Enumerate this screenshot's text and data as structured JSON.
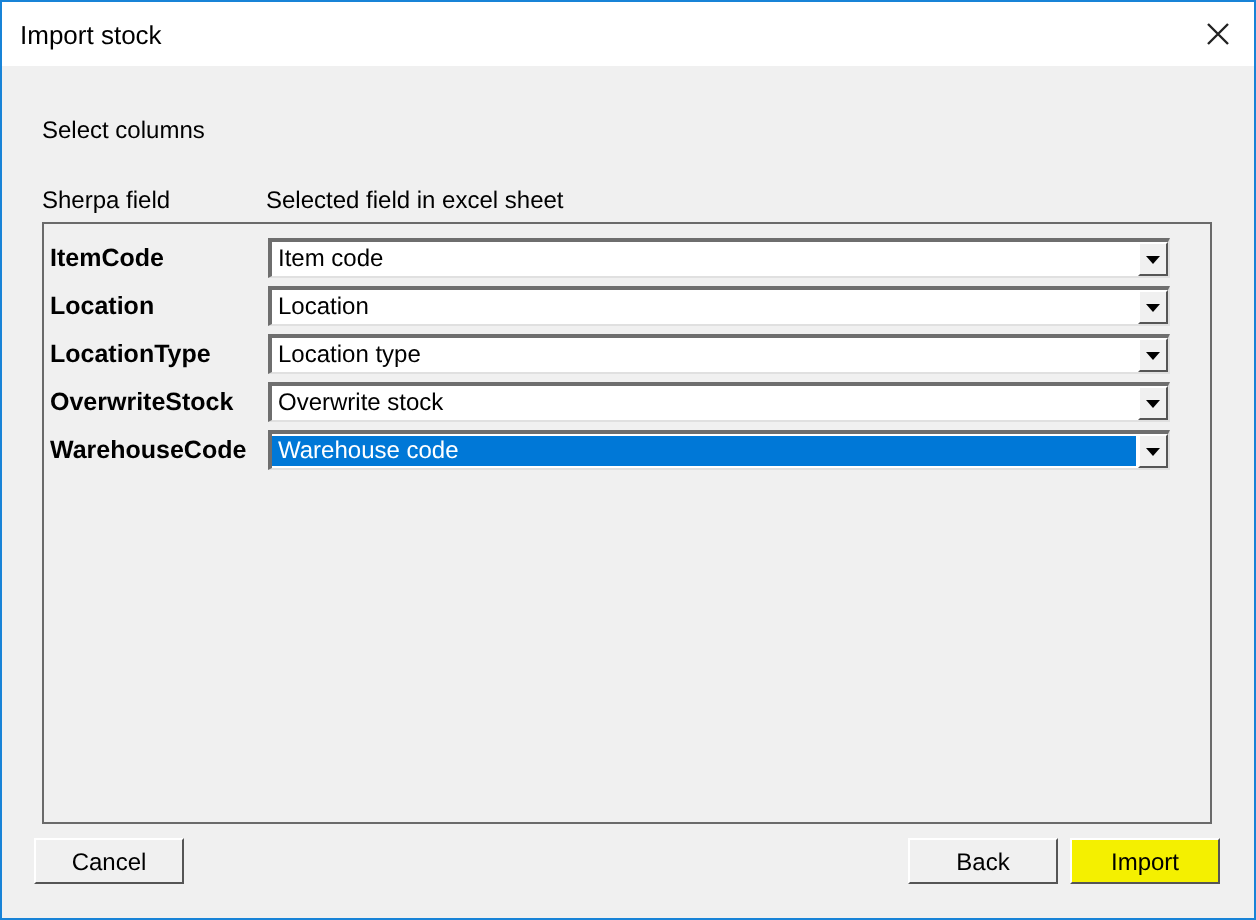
{
  "window": {
    "title": "Import stock"
  },
  "instruction": "Select columns",
  "columns": [
    "Sherpa field",
    "Selected field in excel sheet"
  ],
  "mappings": [
    {
      "field": "ItemCode",
      "value": "Item code",
      "selected": false
    },
    {
      "field": "Location",
      "value": "Location",
      "selected": false
    },
    {
      "field": "LocationType",
      "value": "Location type",
      "selected": false
    },
    {
      "field": "OverwriteStock",
      "value": "Overwrite stock",
      "selected": false
    },
    {
      "field": "WarehouseCode",
      "value": "Warehouse code",
      "selected": true
    }
  ],
  "left_buttons": [
    {
      "label": "Cancel",
      "highlighted": false
    }
  ],
  "right_buttons": [
    {
      "label": "Back",
      "highlighted": false
    },
    {
      "label": "Import",
      "highlighted": true
    }
  ]
}
